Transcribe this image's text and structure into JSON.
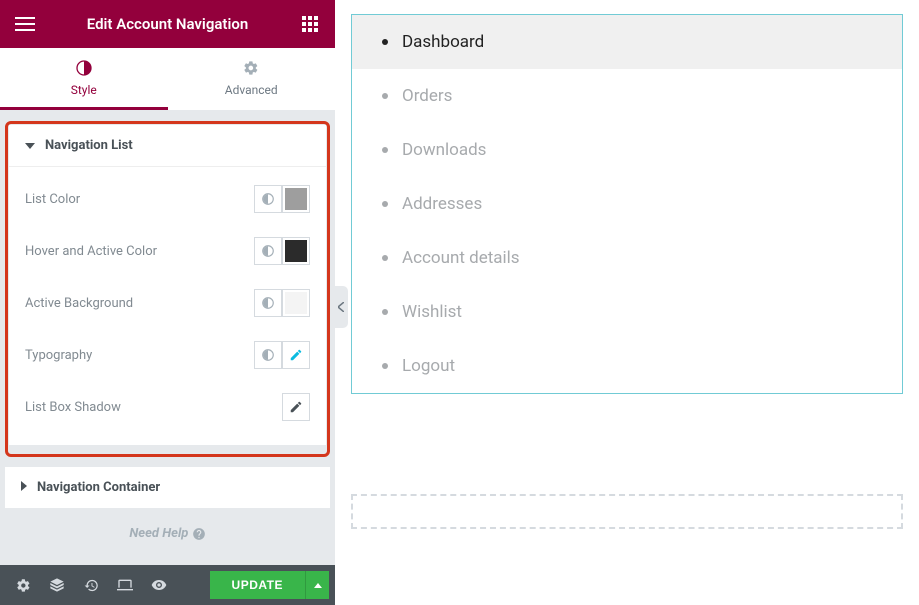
{
  "header": {
    "title": "Edit Account Navigation"
  },
  "tabs": {
    "style": "Style",
    "advanced": "Advanced",
    "active": "style"
  },
  "panels": {
    "navlist": {
      "title": "Navigation List",
      "rows": {
        "list_color": {
          "label": "List Color",
          "swatch": "#9e9e9e"
        },
        "hover_color": {
          "label": "Hover and Active Color",
          "swatch": "#2b2b2b"
        },
        "active_bg": {
          "label": "Active Background",
          "swatch": "#f4f4f4"
        },
        "typography": {
          "label": "Typography"
        },
        "box_shadow": {
          "label": "List Box Shadow"
        }
      }
    },
    "nav_container": {
      "title": "Navigation Container"
    }
  },
  "need_help": "Need Help",
  "footer": {
    "update": "UPDATE"
  },
  "preview": {
    "items": [
      {
        "label": "Dashboard",
        "active": true
      },
      {
        "label": "Orders",
        "active": false
      },
      {
        "label": "Downloads",
        "active": false
      },
      {
        "label": "Addresses",
        "active": false
      },
      {
        "label": "Account details",
        "active": false
      },
      {
        "label": "Wishlist",
        "active": false
      },
      {
        "label": "Logout",
        "active": false
      }
    ]
  },
  "colors": {
    "accent": "#93003c",
    "highlight": "#d4361c",
    "success": "#39b54a"
  }
}
